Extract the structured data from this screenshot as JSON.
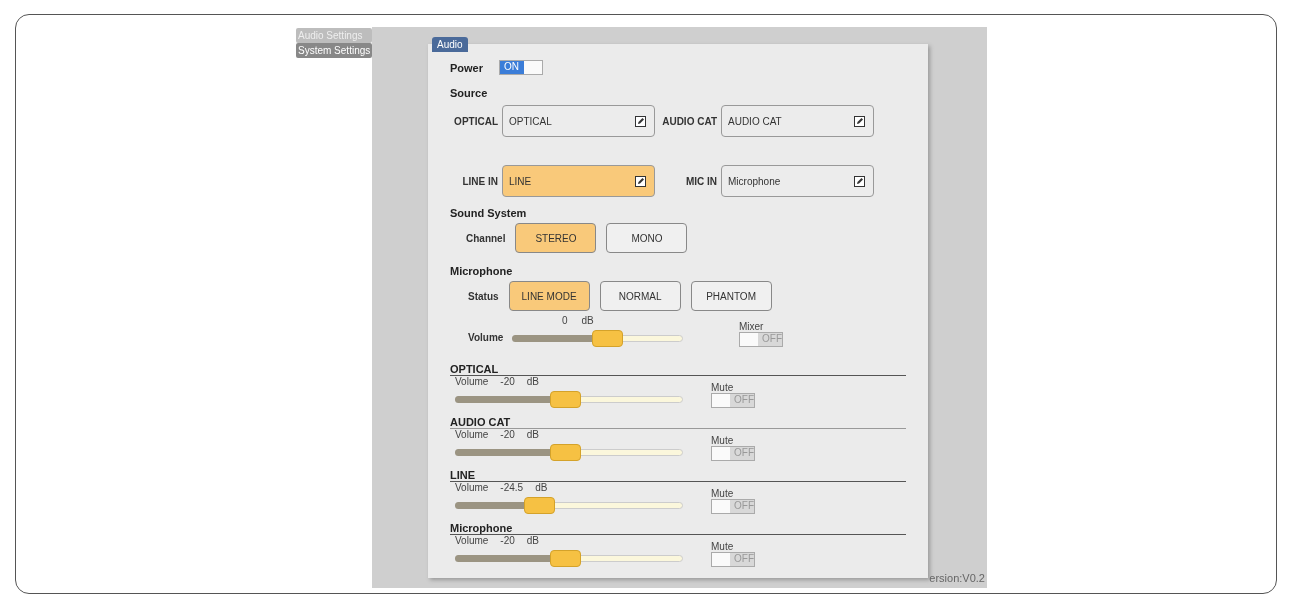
{
  "sidebar": [
    {
      "label": "Audio Settings",
      "selected": true
    },
    {
      "label": "System Settings",
      "selected": false
    }
  ],
  "panel_tab": "Audio",
  "power": {
    "label": "Power",
    "on": true,
    "text": "ON"
  },
  "source": {
    "title": "Source",
    "inputs": [
      {
        "label": "OPTICAL",
        "value": "OPTICAL",
        "selected": false
      },
      {
        "label": "AUDIO CAT",
        "value": "AUDIO CAT",
        "selected": false
      },
      {
        "label": "LINE IN",
        "value": "LINE",
        "selected": true
      },
      {
        "label": "MIC IN",
        "value": "Microphone",
        "selected": false
      }
    ]
  },
  "sound_system": {
    "title": "Sound System",
    "label": "Channel",
    "options": [
      {
        "label": "STEREO",
        "selected": true
      },
      {
        "label": "MONO",
        "selected": false
      }
    ]
  },
  "microphone": {
    "title": "Microphone",
    "label": "Status",
    "options": [
      {
        "label": "LINE MODE",
        "selected": true
      },
      {
        "label": "NORMAL",
        "selected": false
      },
      {
        "label": "PHANTOM",
        "selected": false
      }
    ],
    "volume": {
      "label": "Volume",
      "value": "0",
      "unit": "dB",
      "level": 0.57
    },
    "mixer": {
      "label": "Mixer",
      "on": false,
      "text": "OFF"
    }
  },
  "channels": [
    {
      "name": "OPTICAL",
      "volume_label": "Volume",
      "value": "-20",
      "unit": "dB",
      "level": 0.48,
      "mute_label": "Mute",
      "muted": false,
      "mute_text": "OFF"
    },
    {
      "name": "AUDIO CAT",
      "volume_label": "Volume",
      "value": "-20",
      "unit": "dB",
      "level": 0.48,
      "mute_label": "Mute",
      "muted": false,
      "mute_text": "OFF"
    },
    {
      "name": "LINE",
      "volume_label": "Volume",
      "value": "-24.5",
      "unit": "dB",
      "level": 0.35,
      "mute_label": "Mute",
      "muted": false,
      "mute_text": "OFF"
    },
    {
      "name": "Microphone",
      "volume_label": "Volume",
      "value": "-20",
      "unit": "dB",
      "level": 0.48,
      "mute_label": "Mute",
      "muted": false,
      "mute_text": "OFF"
    }
  ],
  "version": "ersion:V0.2"
}
